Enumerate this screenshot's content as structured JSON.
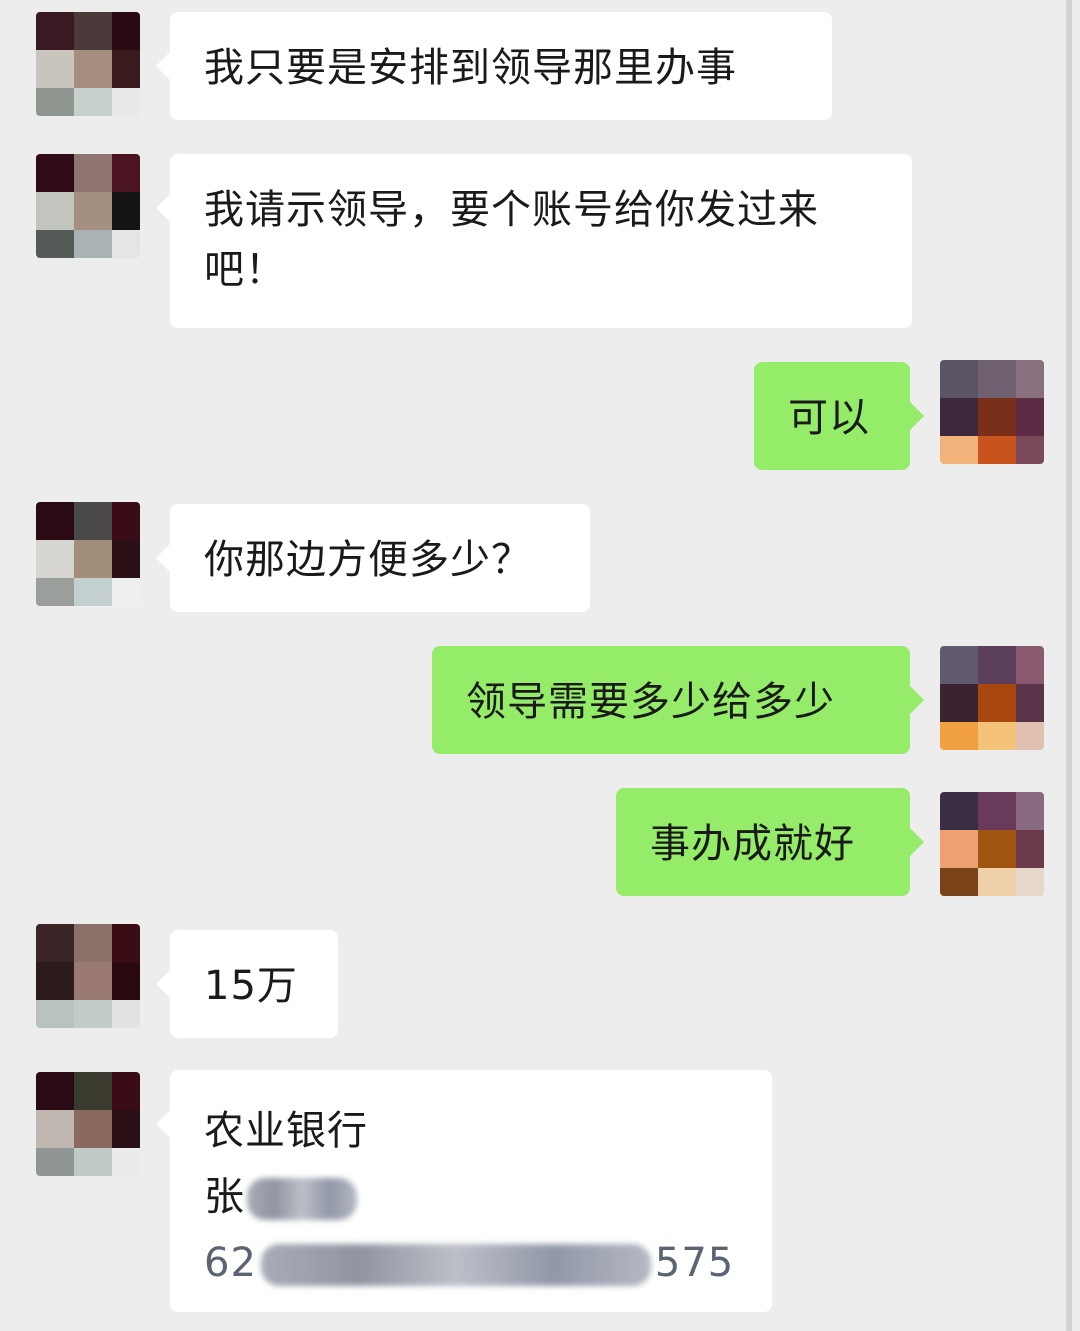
{
  "messages": [
    {
      "side": "in",
      "lines": [
        "我只要是安排到领导那里办事"
      ]
    },
    {
      "side": "in",
      "lines": [
        "我请示领导，要个账号给你发过来",
        "吧！"
      ]
    },
    {
      "side": "out",
      "lines": [
        "可以"
      ]
    },
    {
      "side": "in",
      "lines": [
        "你那边方便多少？"
      ]
    },
    {
      "side": "out",
      "lines": [
        "领导需要多少给多少"
      ]
    },
    {
      "side": "out",
      "lines": [
        "事办成就好"
      ]
    },
    {
      "side": "in",
      "lines": [
        "15万"
      ]
    },
    {
      "side": "in",
      "bank": "农业银行",
      "name_visible": "张",
      "account_visible_start": "62",
      "account_visible_end": "575"
    }
  ],
  "colors": {
    "background": "#ededed",
    "incoming_bubble": "#ffffff",
    "outgoing_bubble": "#95ec69",
    "text": "#1a1a1a"
  },
  "icons": {
    "avatar_incoming": "pixelated-avatar-icon",
    "avatar_outgoing": "pixelated-avatar-icon"
  }
}
